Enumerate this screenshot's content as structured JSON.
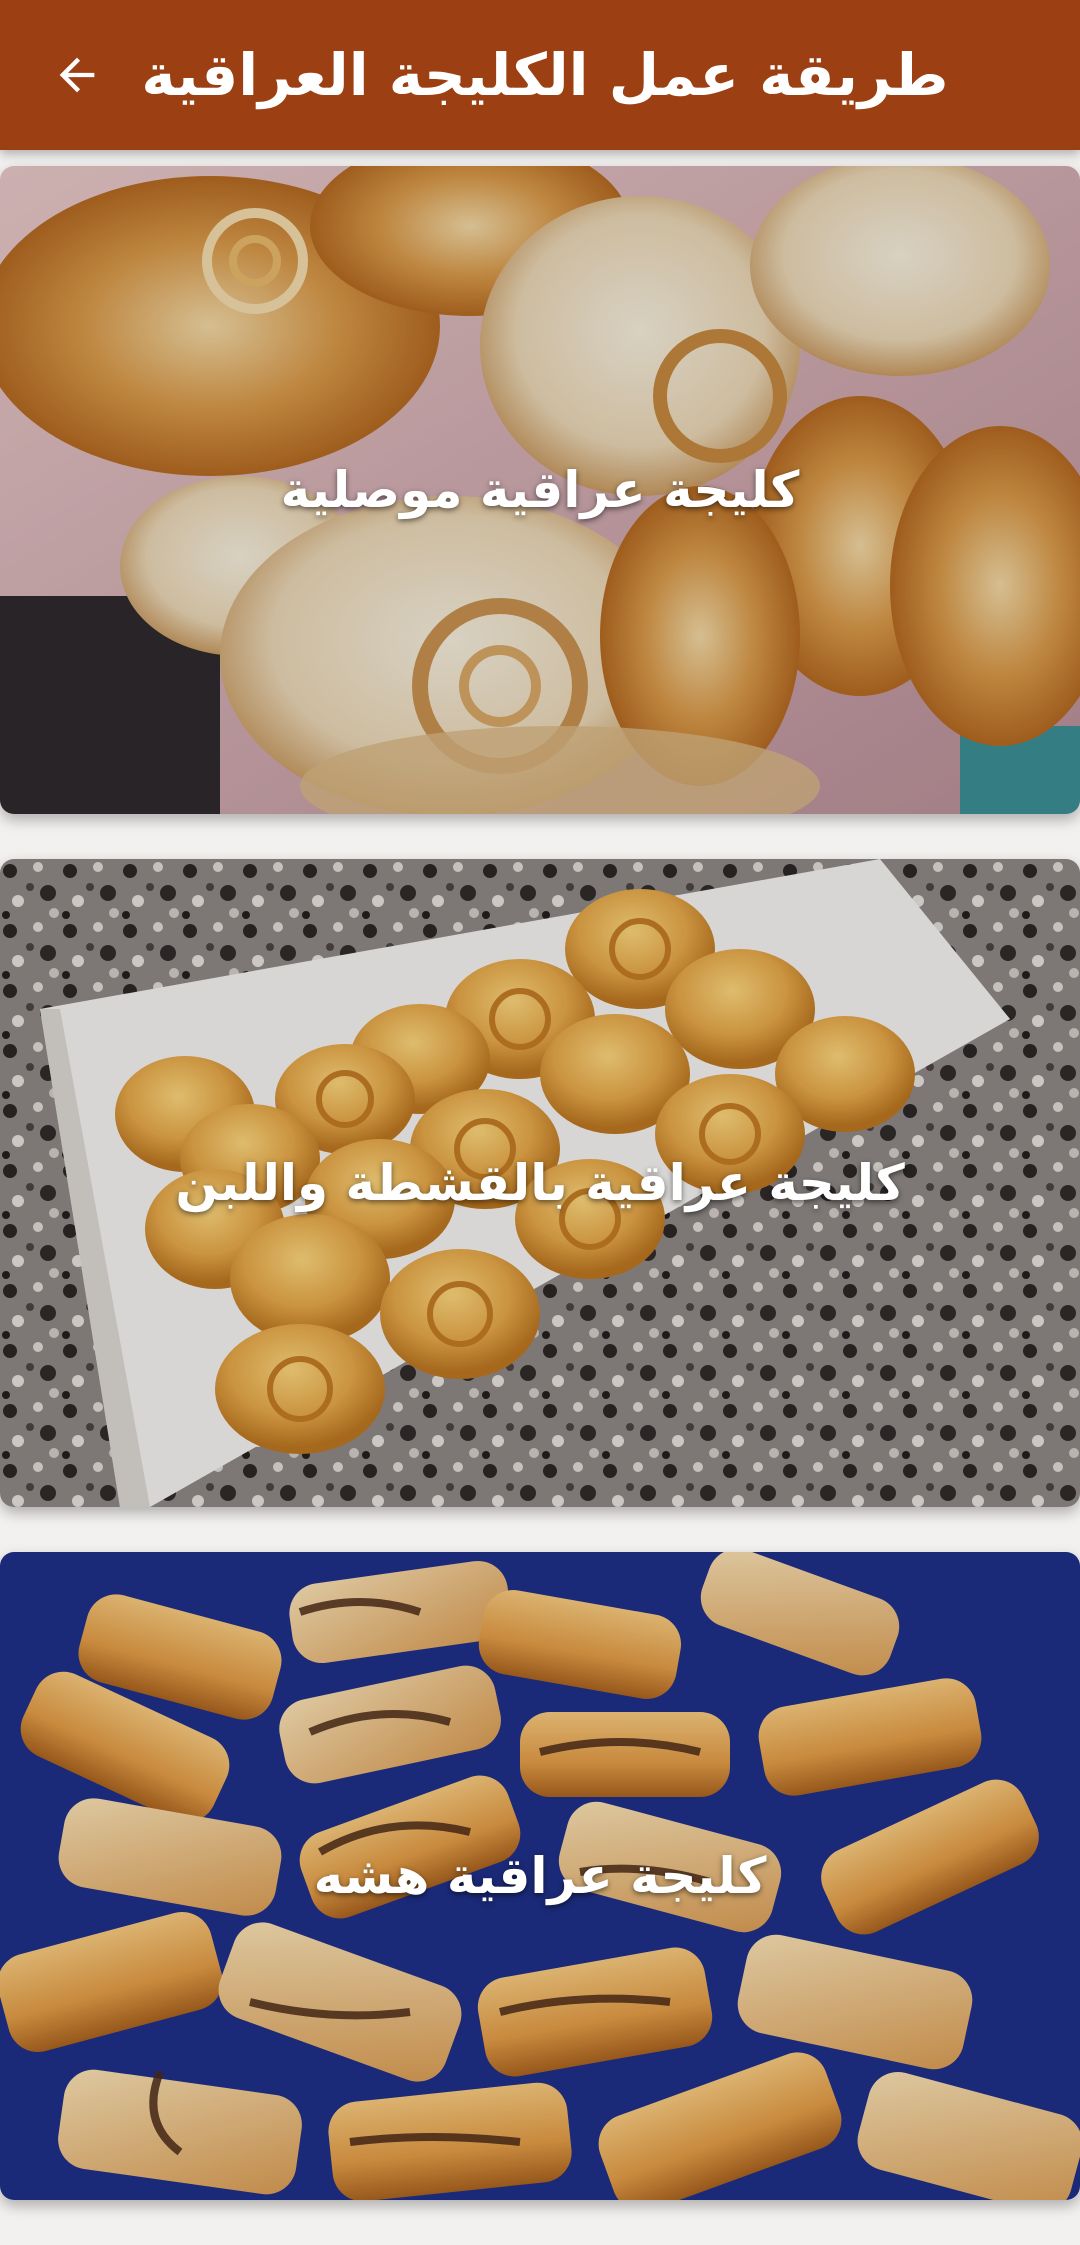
{
  "app_bar": {
    "title": "طريقة عمل الكليجة العراقية",
    "back_icon": "arrow-back-icon",
    "background": "#9c3f12"
  },
  "recipes": [
    {
      "title": "كليجة عراقية موصلية"
    },
    {
      "title": "كليجة عراقية بالقشطة واللبن"
    },
    {
      "title": "كليجة عراقية هشه"
    }
  ]
}
